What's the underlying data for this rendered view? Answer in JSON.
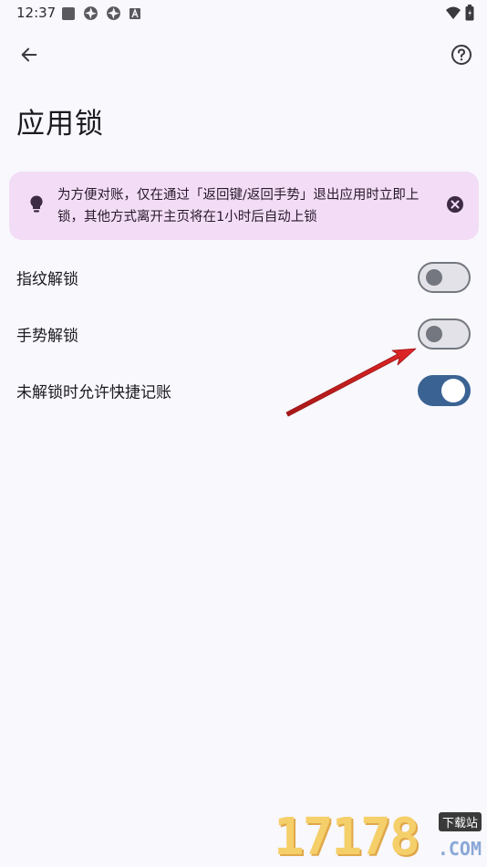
{
  "status_bar": {
    "time": "12:37",
    "left_icons": [
      "app-square-icon",
      "aperture-icon",
      "aperture-icon",
      "a-badge-icon"
    ],
    "right_icons": [
      "wifi-icon",
      "battery-icon"
    ]
  },
  "app_bar": {
    "back_icon": "arrow-left-icon",
    "help_icon": "help-circle-icon"
  },
  "page": {
    "title": "应用锁"
  },
  "banner": {
    "text": "为方便对账，仅在通过「返回键/返回手势」退出应用时立即上锁，其他方式离开主页将在1小时后自动上锁",
    "icon": "lightbulb-icon",
    "close_icon": "close-circle-icon",
    "background": "#f3ddf6"
  },
  "settings": [
    {
      "label": "指纹解锁",
      "enabled": false
    },
    {
      "label": "手势解锁",
      "enabled": false
    },
    {
      "label": "未解锁时允许快捷记账",
      "enabled": true
    }
  ],
  "colors": {
    "accent": "#3a6393",
    "annotation_arrow": "#d42020",
    "background": "#f8f8fd"
  },
  "watermark": {
    "digits": "17178",
    "tag": "下载站",
    "domain": ".COM"
  }
}
